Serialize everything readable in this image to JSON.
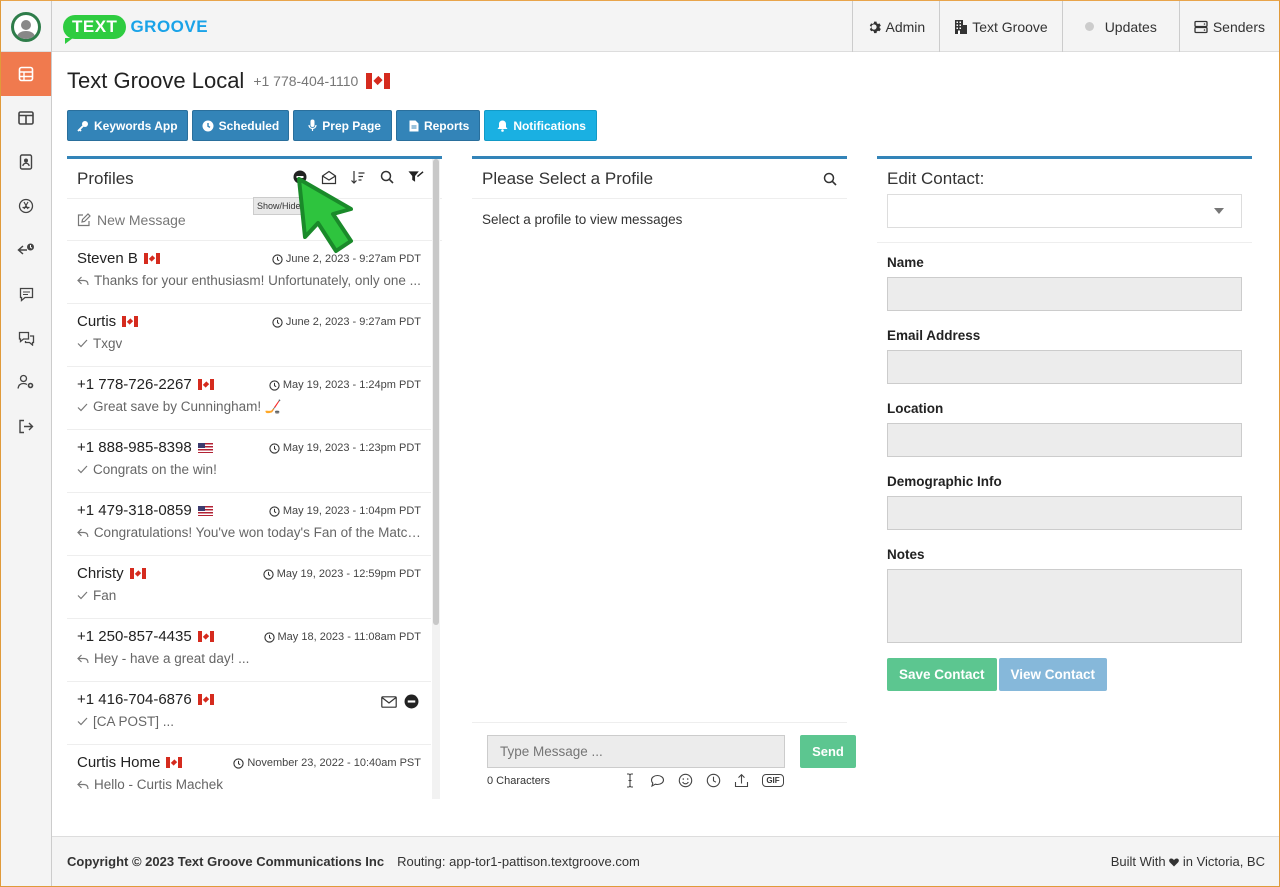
{
  "app": {
    "brand_bubble": "TEXT",
    "brand_word": "GROOVE"
  },
  "topnav": [
    {
      "label": "Admin",
      "icon": "gear-icon"
    },
    {
      "label": "Text Groove",
      "icon": "building-icon"
    },
    {
      "label": "Updates",
      "icon": "status-dot"
    },
    {
      "label": "Senders",
      "icon": "server-icon"
    }
  ],
  "sidebar": [
    "dashboard-icon",
    "columns-icon",
    "contacts-book-icon",
    "app-store-icon",
    "reply-clock-icon",
    "message-square-icon",
    "chat-bubbles-icon",
    "user-settings-icon",
    "sign-out-icon"
  ],
  "page": {
    "title": "Text Groove Local",
    "phone": "+1 778-404-1110",
    "country": "CA"
  },
  "toolbar": {
    "keywords": "Keywords App",
    "scheduled": "Scheduled",
    "prep": "Prep Page",
    "reports": "Reports",
    "notifications": "Notifications"
  },
  "profiles": {
    "title": "Profiles",
    "tooltip": "Show/Hide Blocked",
    "new_message": "New Message",
    "items": [
      {
        "name": "Steven B",
        "flag": "CA",
        "date": "June 2, 2023 - 9:27am PDT",
        "status": "reply",
        "message": "Thanks for your enthusiasm! Unfortunately, only one ..."
      },
      {
        "name": "Curtis",
        "flag": "CA",
        "date": "June 2, 2023 - 9:27am PDT",
        "status": "check",
        "message": "Txgv"
      },
      {
        "name": "+1 778-726-2267",
        "flag": "CA",
        "date": "May 19, 2023 - 1:24pm PDT",
        "status": "check",
        "message": "Great save by Cunningham! 🏒"
      },
      {
        "name": "+1 888-985-8398",
        "flag": "US",
        "date": "May 19, 2023 - 1:23pm PDT",
        "status": "check",
        "message": "Congrats on the win!"
      },
      {
        "name": "+1 479-318-0859",
        "flag": "US",
        "date": "May 19, 2023 - 1:04pm PDT",
        "status": "reply",
        "message": "Congratulations! You've won today's Fan of the Match..."
      },
      {
        "name": "Christy",
        "flag": "CA",
        "date": "May 19, 2023 - 12:59pm PDT",
        "status": "check",
        "message": "Fan"
      },
      {
        "name": "+1 250-857-4435",
        "flag": "CA",
        "date": "May 18, 2023 - 11:08am PDT",
        "status": "reply",
        "message": "Hey - have a great day! ..."
      },
      {
        "name": "+1 416-704-6876",
        "flag": "CA",
        "date": "",
        "status": "check",
        "message": "[CA POST] ...",
        "blocked": true
      },
      {
        "name": "Curtis Home",
        "flag": "CA",
        "date": "November 23, 2022 - 10:40am PST",
        "status": "reply",
        "message": "Hello - Curtis Machek"
      }
    ]
  },
  "conversation": {
    "title": "Please Select a Profile",
    "empty": "Select a profile to view messages",
    "input_placeholder": "Type Message ...",
    "send": "Send",
    "char_count": "0 Characters",
    "gif": "GIF"
  },
  "contact": {
    "title": "Edit Contact:",
    "name_label": "Name",
    "email_label": "Email Address",
    "location_label": "Location",
    "demo_label": "Demographic Info",
    "notes_label": "Notes",
    "save": "Save Contact",
    "view": "View Contact"
  },
  "footer": {
    "copyright": "Copyright © 2023 Text Groove Communications Inc",
    "routing": "Routing: app-tor1-pattison.textgroove.com",
    "built": "Built With",
    "built_after": "in Victoria, BC"
  },
  "colors": {
    "accent": "#3384b8",
    "notif": "#1ab0e2",
    "active_side": "#f07a4e",
    "success": "#5cc690"
  }
}
